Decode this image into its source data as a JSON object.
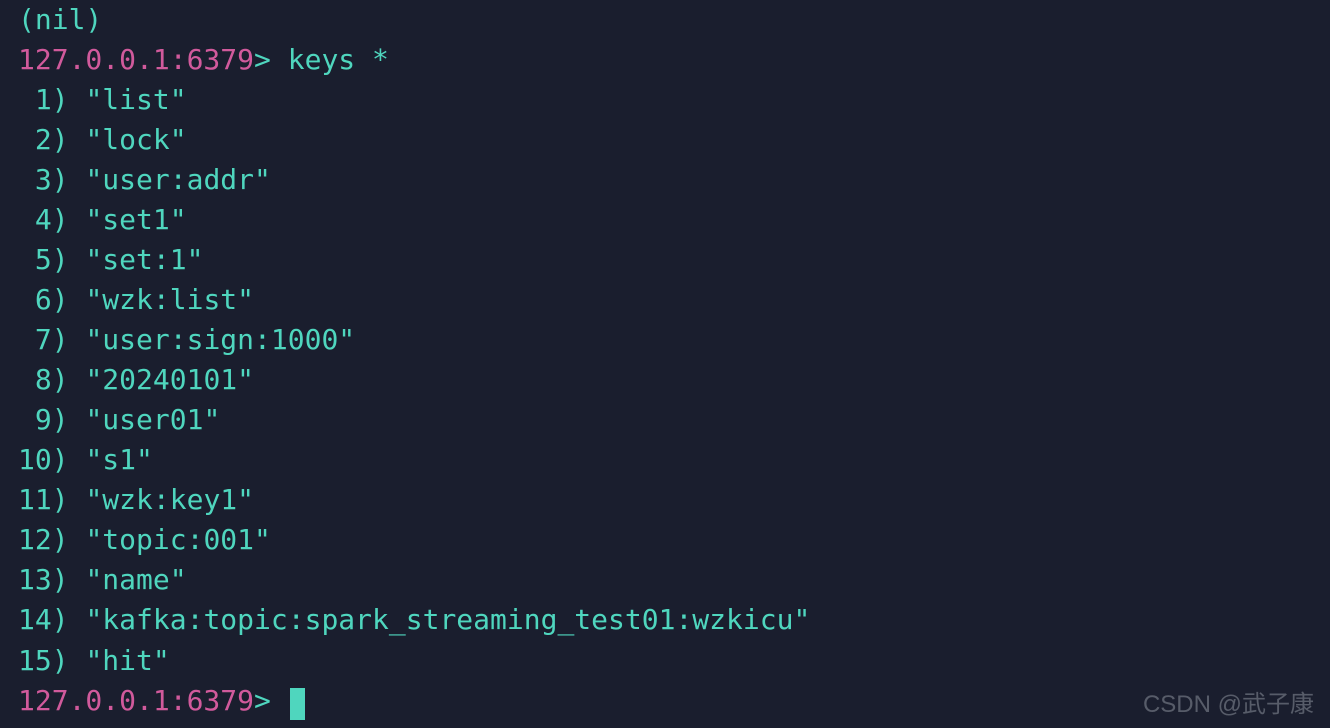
{
  "top_partial": "(nil)",
  "prompt": {
    "host": "127.0.0.1",
    "port": "6379",
    "arrow": ">"
  },
  "command": "keys *",
  "results": [
    {
      "idx": " 1",
      "v": "\"list\""
    },
    {
      "idx": " 2",
      "v": "\"lock\""
    },
    {
      "idx": " 3",
      "v": "\"user:addr\""
    },
    {
      "idx": " 4",
      "v": "\"set1\""
    },
    {
      "idx": " 5",
      "v": "\"set:1\""
    },
    {
      "idx": " 6",
      "v": "\"wzk:list\""
    },
    {
      "idx": " 7",
      "v": "\"user:sign:1000\""
    },
    {
      "idx": " 8",
      "v": "\"20240101\""
    },
    {
      "idx": " 9",
      "v": "\"user01\""
    },
    {
      "idx": "10",
      "v": "\"s1\""
    },
    {
      "idx": "11",
      "v": "\"wzk:key1\""
    },
    {
      "idx": "12",
      "v": "\"topic:001\""
    },
    {
      "idx": "13",
      "v": "\"name\""
    },
    {
      "idx": "14",
      "v": "\"kafka:topic:spark_streaming_test01:wzkicu\""
    },
    {
      "idx": "15",
      "v": "\"hit\""
    }
  ],
  "watermark": "CSDN @武子康"
}
